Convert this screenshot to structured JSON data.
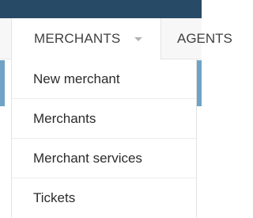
{
  "nav": {
    "merchants_label": "MERCHANTS",
    "caret_icon": "caret-down-icon",
    "next_label": "AGENTS"
  },
  "dropdown": {
    "items": [
      {
        "label": "New merchant"
      },
      {
        "label": "Merchants"
      },
      {
        "label": "Merchant services"
      },
      {
        "label": "Tickets"
      }
    ]
  },
  "colors": {
    "top_bar": "#274a66",
    "accent": "#6ea3c5",
    "text": "#2b2b2b"
  }
}
